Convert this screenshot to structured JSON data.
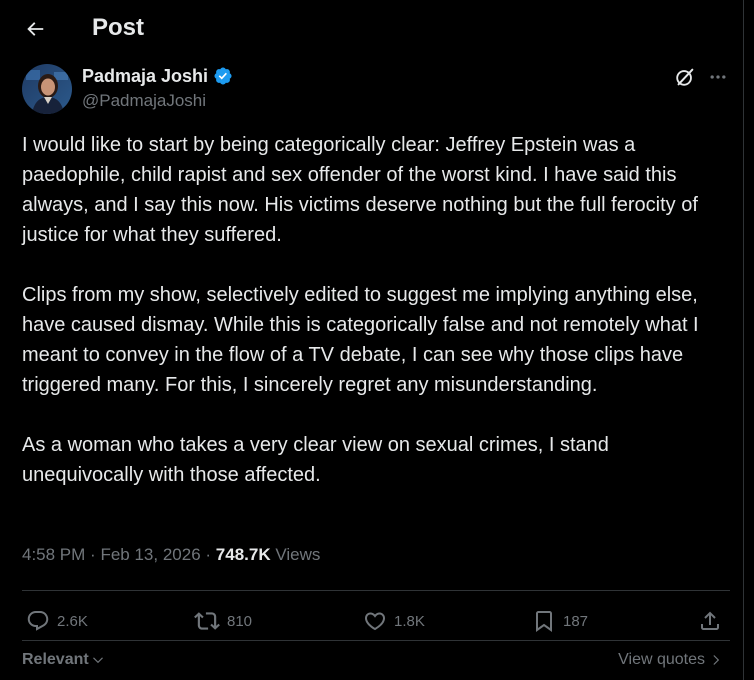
{
  "header": {
    "title": "Post",
    "back_icon": "arrow-left-icon"
  },
  "author": {
    "name": "Padmaja Joshi",
    "handle": "@PadmajaJoshi",
    "verified_icon": "verified-badge-icon",
    "verified_color": "#1d9bf0"
  },
  "toolbar": {
    "grok_icon": "grok-icon",
    "more_icon": "more-horizontal-icon"
  },
  "post": {
    "paragraphs": [
      "I would like to start by being categorically clear: Jeffrey Epstein was a paedophile, child rapist and sex offender of the worst kind. I have said this always, and I say this now. His victims deserve nothing but the full ferocity of justice for what they suffered.",
      "Clips from my show, selectively edited to suggest me implying anything else, have caused dismay. While this is categorically false and not remotely what I meant to convey in the flow of a TV debate, I can see why those clips have triggered many. For this, I sincerely regret any misunderstanding.",
      "As a woman who takes a very clear view on sexual crimes, I stand unequivocally with those affected."
    ],
    "time": "4:58 PM",
    "separator": "·",
    "date": "Feb 13, 2026",
    "views_count": "748.7K",
    "views_label": "Views"
  },
  "actions": {
    "replies": {
      "icon": "reply-icon",
      "count": "2.6K"
    },
    "reposts": {
      "icon": "repost-icon",
      "count": "810"
    },
    "likes": {
      "icon": "heart-icon",
      "count": "1.8K"
    },
    "bookmarks": {
      "icon": "bookmark-icon",
      "count": "187"
    },
    "share": {
      "icon": "share-icon"
    }
  },
  "footer": {
    "sort_label": "Relevant",
    "sort_icon": "chevron-down-icon",
    "quotes_label": "View quotes",
    "quotes_icon": "chevron-right-icon"
  },
  "colors": {
    "background": "#000000",
    "text_primary": "#e7e9ea",
    "text_secondary": "#71767b",
    "divider": "#2f3336",
    "accent": "#1d9bf0"
  }
}
